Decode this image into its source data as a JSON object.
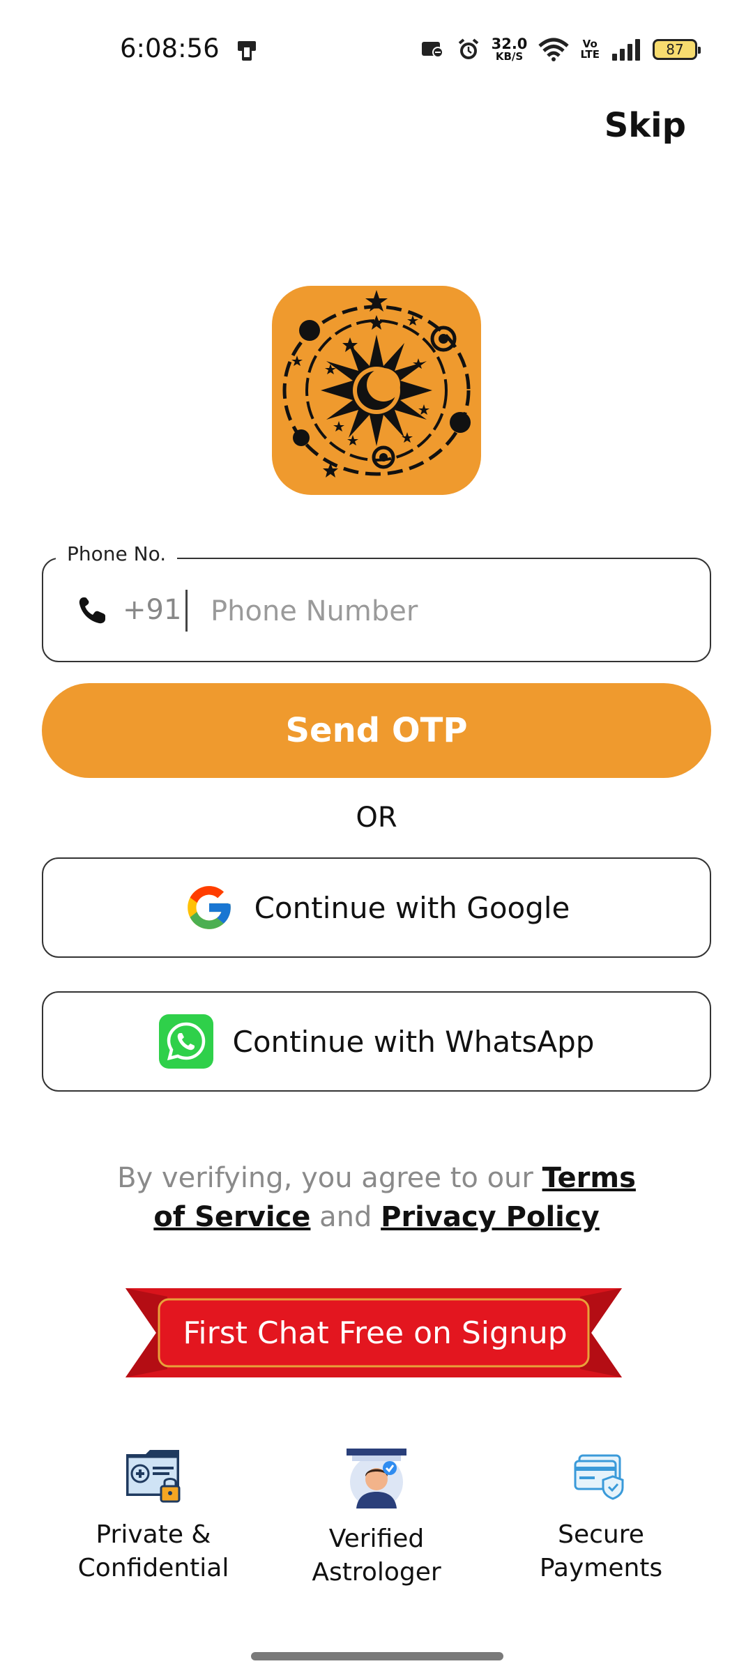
{
  "status_bar": {
    "time": "6:08:56",
    "net_speed_value": "32.0",
    "net_speed_unit": "KB/S",
    "volte_top": "Vo",
    "volte_bottom": "LTE",
    "battery": "87"
  },
  "header": {
    "skip_label": "Skip"
  },
  "phone_field": {
    "legend": "Phone No.",
    "country_code": "+91",
    "placeholder": "Phone Number",
    "value": ""
  },
  "actions": {
    "send_otp_label": "Send OTP",
    "or_label": "OR",
    "google_label": "Continue with Google",
    "whatsapp_label": "Continue with WhatsApp"
  },
  "terms": {
    "prefix": "By verifying, you agree to our",
    "terms_link": "Terms of Service",
    "joiner": "and",
    "privacy_link": "Privacy Policy"
  },
  "promo": {
    "label": "First Chat Free on Signup"
  },
  "features": [
    {
      "line1": "Private &",
      "line2": "Confidential",
      "icon": "private-folder-icon"
    },
    {
      "line1": "Verified",
      "line2": "Astrologer",
      "icon": "verified-astrologer-icon"
    },
    {
      "line1": "Secure",
      "line2": "Payments",
      "icon": "secure-payment-card-icon"
    }
  ],
  "colors": {
    "accent": "#ef9a2e",
    "promo_red": "#d9141c",
    "whatsapp_green": "#2fd04a"
  }
}
